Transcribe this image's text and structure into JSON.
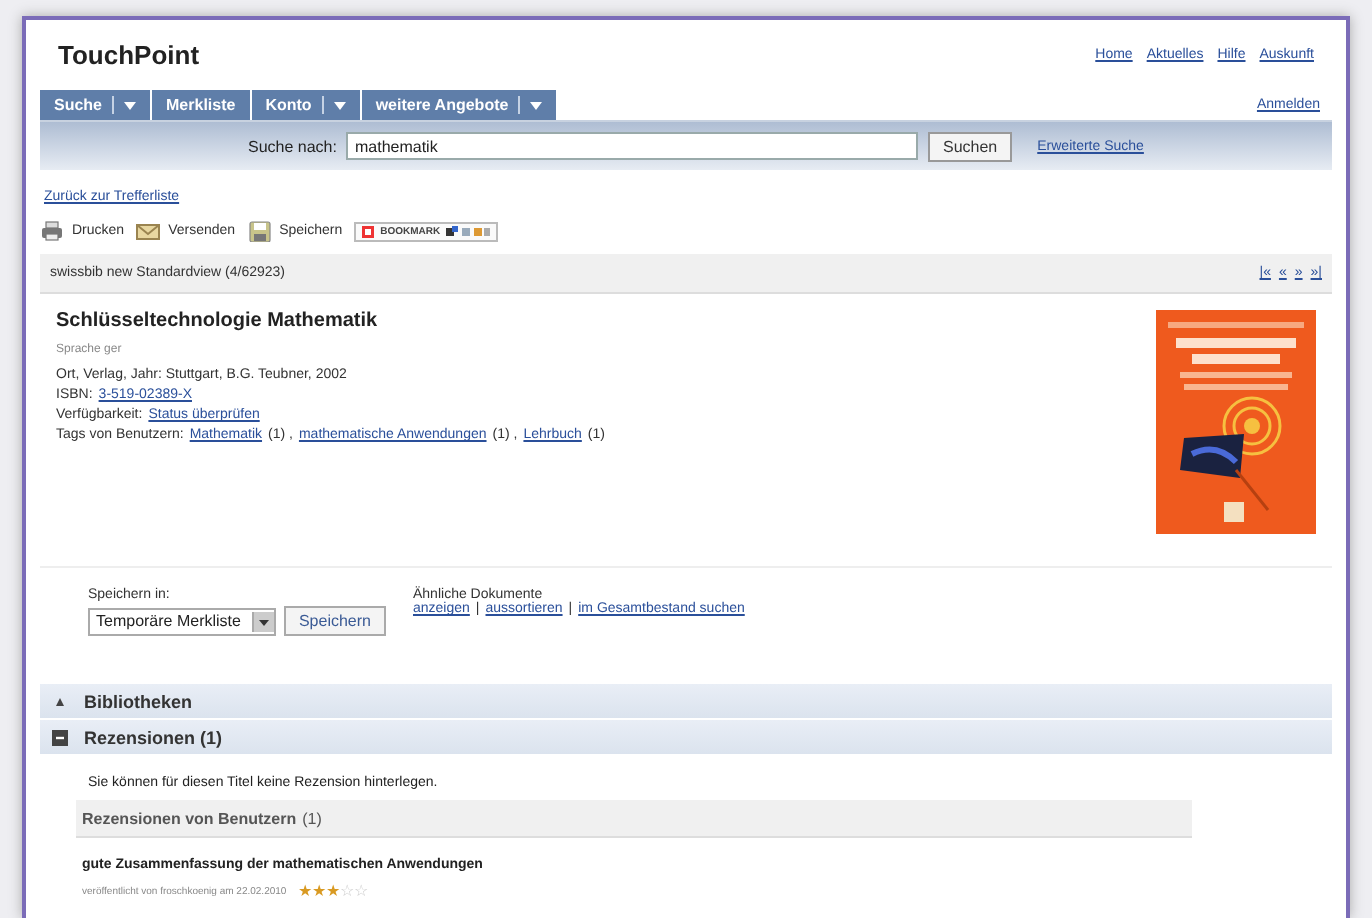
{
  "header": {
    "logo": "TouchPoint",
    "links": [
      "Home",
      "Aktuelles",
      "Hilfe",
      "Auskunft"
    ]
  },
  "nav": {
    "tabs": [
      {
        "label": "Suche",
        "menu": true
      },
      {
        "label": "Merkliste",
        "menu": false
      },
      {
        "label": "Konto",
        "menu": true
      },
      {
        "label": "weitere Angebote",
        "menu": true
      }
    ],
    "login": "Anmelden"
  },
  "search": {
    "label": "Suche nach:",
    "value": "mathematik",
    "button": "Suchen",
    "advanced": "Erweiterte Suche"
  },
  "back_link": "Zurück zur Trefferliste",
  "toolbar": [
    {
      "kind": "print",
      "label": "Drucken"
    },
    {
      "kind": "mail",
      "label": "Versenden"
    },
    {
      "kind": "save",
      "label": "Speichern"
    },
    {
      "kind": "bookmark",
      "label": "BOOKMARK"
    }
  ],
  "result_bar": {
    "title": "swissbib new Standardview (4/62923)",
    "pager": [
      "|«",
      "«",
      "»",
      "»|"
    ]
  },
  "record": {
    "title": "Schlüsseltechnologie Mathematik",
    "language": "Sprache ger",
    "publication": "Ort, Verlag, Jahr: Stuttgart, B.G. Teubner, 2002",
    "isbn_label": "ISBN:",
    "isbn": "3-519-02389-X",
    "availability_label": "Verfügbarkeit:",
    "availability": "Status überprüfen",
    "tags_label": "Tags von Benutzern:",
    "tags": [
      {
        "name": "Mathematik",
        "count": "(1) ,"
      },
      {
        "name": "mathematische Anwendungen",
        "count": "(1) ,"
      },
      {
        "name": "Lehrbuch",
        "count": "(1)"
      }
    ]
  },
  "save": {
    "label": "Speichern in:",
    "list": "Temporäre Merkliste",
    "button": "Speichern"
  },
  "similar": {
    "label": "Ähnliche Dokumente",
    "separator": "|",
    "links": [
      "anzeigen",
      "aussortieren",
      "im Gesamtbestand suchen"
    ]
  },
  "sections": [
    {
      "label": "Bibliotheken",
      "expanded": false
    },
    {
      "label": "Rezensionen (1)",
      "expanded": true
    }
  ],
  "reviews": {
    "note": "Sie können für diesen Titel keine Rezension hinterlegen.",
    "heading": "Rezensionen von Benutzern",
    "count": "(1)",
    "items": [
      {
        "title": "gute Zusammenfassung der mathematischen Anwendungen",
        "meta": "veröffentlicht von froschkoenig am 22.02.2010",
        "stars": 3
      }
    ]
  }
}
